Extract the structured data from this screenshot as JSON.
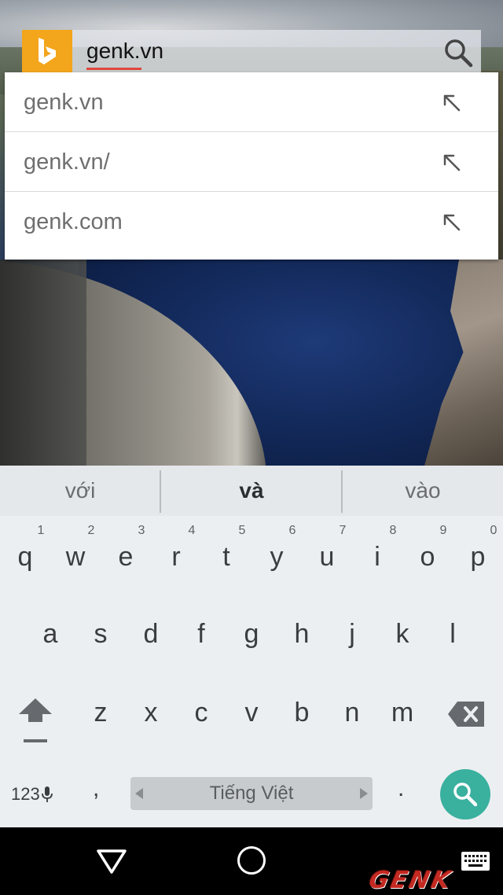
{
  "search": {
    "query": "genk.vn"
  },
  "suggestions": [
    {
      "text": "genk.vn"
    },
    {
      "text": "genk.vn/"
    },
    {
      "text": "genk.com"
    }
  ],
  "keyboard": {
    "candidates": [
      "với",
      "và",
      "vào"
    ],
    "row1": [
      {
        "letter": "q",
        "hint": "1"
      },
      {
        "letter": "w",
        "hint": "2"
      },
      {
        "letter": "e",
        "hint": "3"
      },
      {
        "letter": "r",
        "hint": "4"
      },
      {
        "letter": "t",
        "hint": "5"
      },
      {
        "letter": "y",
        "hint": "6"
      },
      {
        "letter": "u",
        "hint": "7"
      },
      {
        "letter": "i",
        "hint": "8"
      },
      {
        "letter": "o",
        "hint": "9"
      },
      {
        "letter": "p",
        "hint": "0"
      }
    ],
    "row2": [
      "a",
      "s",
      "d",
      "f",
      "g",
      "h",
      "j",
      "k",
      "l"
    ],
    "row3": [
      "z",
      "x",
      "c",
      "v",
      "b",
      "n",
      "m"
    ],
    "num_label": "123",
    "comma": ",",
    "space_label": "Tiếng Việt",
    "period": "."
  },
  "watermark": "GENK",
  "colors": {
    "bing_orange": "#f3a51b",
    "accent_teal": "#3ab09f",
    "underline_red": "#e0453c"
  }
}
